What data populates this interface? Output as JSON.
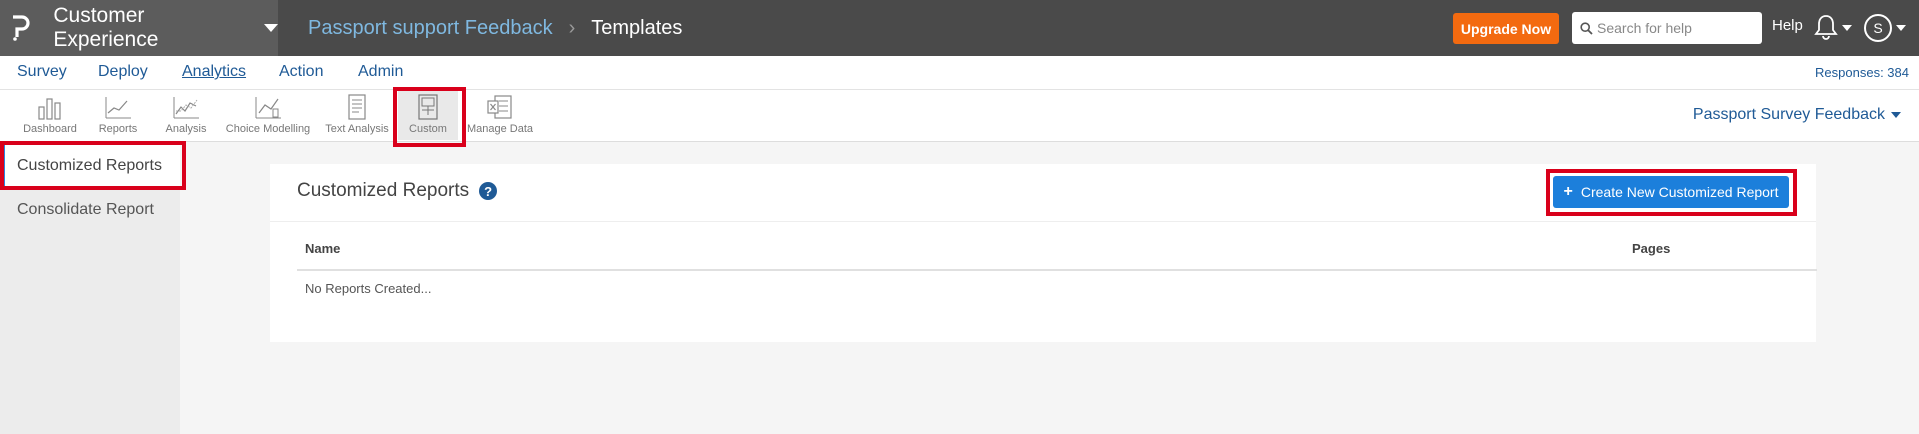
{
  "topbar": {
    "product": "Customer Experience",
    "crumb_parent": "Passport support Feedback",
    "crumb_current": "Templates",
    "upgrade_label": "Upgrade Now",
    "search_placeholder": "Search for help",
    "help_label": "Help",
    "avatar_letter": "S"
  },
  "mainnav": {
    "items": [
      "Survey",
      "Deploy",
      "Analytics",
      "Action",
      "Admin"
    ],
    "active": "Analytics",
    "responses": "Responses: 384"
  },
  "tools": [
    {
      "label": "Dashboard",
      "icon": "dashboard-icon"
    },
    {
      "label": "Reports",
      "icon": "reports-icon"
    },
    {
      "label": "Analysis",
      "icon": "analysis-icon"
    },
    {
      "label": "Choice Modelling",
      "icon": "choice-modelling-icon"
    },
    {
      "label": "Text Analysis",
      "icon": "text-analysis-icon"
    },
    {
      "label": "Custom",
      "icon": "custom-icon"
    },
    {
      "label": "Manage Data",
      "icon": "manage-data-icon"
    }
  ],
  "survey_select": "Passport Survey Feedback",
  "sidebar": {
    "items": [
      {
        "label": "Customized Reports",
        "active": true
      },
      {
        "label": "Consolidate Report",
        "active": false
      }
    ]
  },
  "panel": {
    "title": "Customized Reports",
    "help_glyph": "?",
    "create_button": "Create New Customized Report",
    "plus": "+",
    "columns": [
      "Name",
      "Pages"
    ],
    "empty_text": "No Reports Created..."
  },
  "colors": {
    "highlight": "#d9001b",
    "primary": "#1c7fdb",
    "upgrade": "#f36a10",
    "nav_text": "#1f5a96"
  }
}
